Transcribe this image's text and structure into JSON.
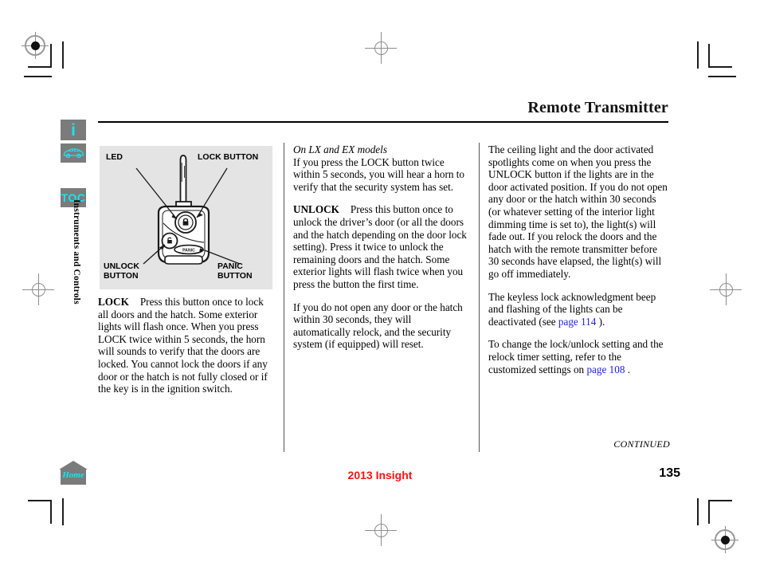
{
  "header": {
    "title": "Remote Transmitter"
  },
  "sidebar": {
    "items": [
      {
        "name": "info",
        "icon": "info-icon",
        "label": "i"
      },
      {
        "name": "car",
        "icon": "car-icon",
        "label": ""
      },
      {
        "name": "toc",
        "icon": "toc-icon",
        "label": "TOC"
      }
    ],
    "section_label": "Instruments and Controls"
  },
  "figure": {
    "caption_labels": {
      "led": "LED",
      "lock": "LOCK BUTTON",
      "unlock": "UNLOCK\nBUTTON",
      "panic": "PANIC\nBUTTON",
      "panic_button_text": "PANIC"
    }
  },
  "columns": {
    "left": {
      "lock_heading": "LOCK",
      "lock_body": "Press this button once to lock all doors and the hatch. Some exterior lights will flash once. When you press LOCK twice within 5 seconds, the horn will sounds to verify that the doors are locked. You cannot lock the doors if any door or the hatch is not fully closed or if the key is in the ignition switch."
    },
    "middle": {
      "models_heading": "On LX and EX models",
      "models_body": "If you press the LOCK button twice within 5 seconds, you will hear a horn to verify that the security system has set.",
      "unlock_heading": "UNLOCK",
      "unlock_body": "Press this button once to unlock the driver’s door (or all the doors and the hatch depending on the door lock setting). Press it twice to unlock the remaining doors and the hatch. Some exterior lights will flash twice when you press the button the first time.",
      "relock_body": "If you do not open any door or the hatch within 30 seconds, they will automatically relock, and the security system (if equipped) will reset."
    },
    "right": {
      "para1": "The ceiling light and the door activated spotlights come on when you press the UNLOCK button if the lights are in the door activated position. If you do not open any door or the hatch within 30 seconds (or whatever setting of the interior light dimming time is set to), the light(s) will fade out. If you relock the doors and the hatch with the remote transmitter before 30 seconds have elapsed, the light(s) will go off immediately.",
      "para2_before": "The keyless lock acknowledgment beep and flashing of the lights can be deactivated (see ",
      "para2_link": "page 114",
      "para2_after": " ).",
      "para3_before": "To change the lock/unlock setting and the relock timer setting, refer to the customized settings on ",
      "para3_link": "page 108",
      "para3_after": " ."
    }
  },
  "footer": {
    "continued": "CONTINUED",
    "home_label": "Home",
    "model_year": "2013 Insight",
    "page_number": "135"
  },
  "colors": {
    "accent_cyan": "#16e6f0",
    "tab_gray": "#7b7b7b",
    "figure_bg": "#e4e4e4",
    "link_blue": "#2222dd",
    "footer_red": "#ff1111"
  }
}
